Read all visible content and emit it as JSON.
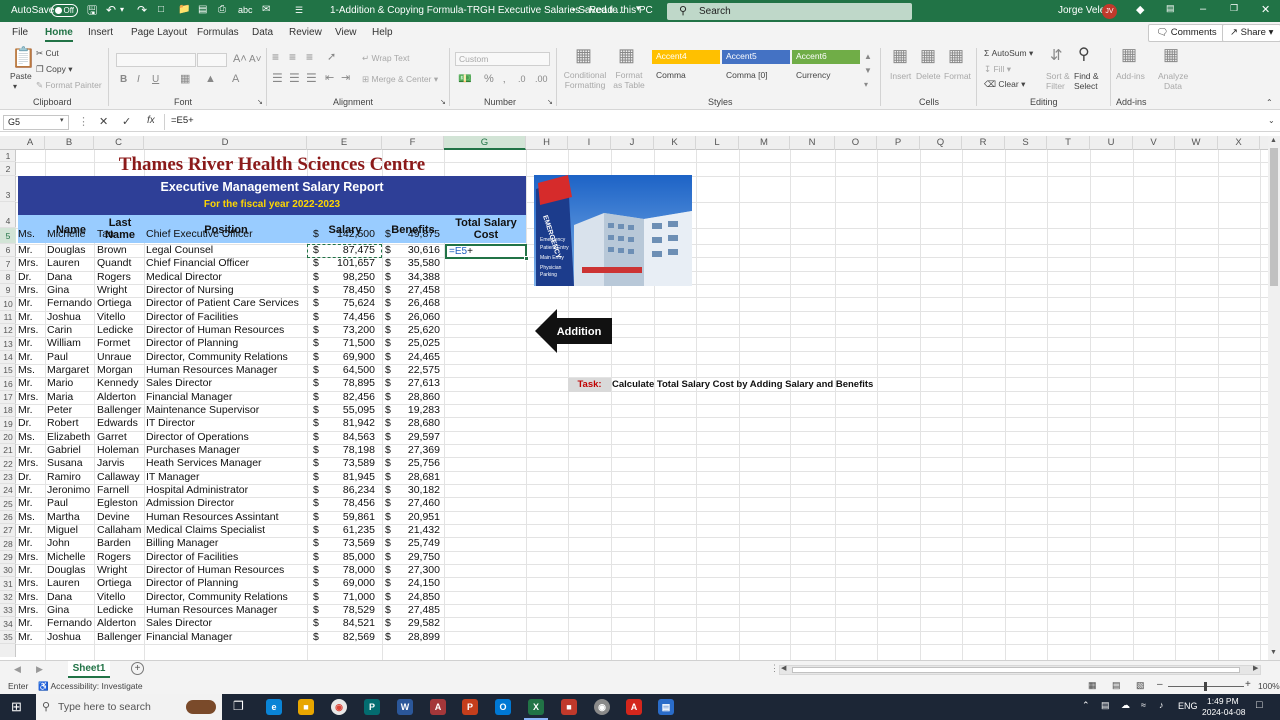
{
  "titlebar": {
    "autosave": "AutoSave",
    "autosave_state": "Off",
    "doc_title": "1-Addition & Copying Formula-TRGH Executive Salaries - Read-...",
    "saved": "• Saved to this PC",
    "search_placeholder": "Search",
    "user": "Jorge Velez",
    "user_initials": "JV"
  },
  "menu": {
    "tabs": [
      "File",
      "Home",
      "Insert",
      "Page Layout",
      "Formulas",
      "Data",
      "Review",
      "View",
      "Help"
    ],
    "comments": "Comments",
    "share": "Share"
  },
  "ribbon": {
    "clipboard": {
      "paste": "Paste",
      "cut": "Cut",
      "copy": "Copy",
      "format_painter": "Format Painter",
      "label": "Clipboard"
    },
    "font": {
      "label": "Font",
      "bold": "B",
      "italic": "I",
      "underline": "U"
    },
    "alignment": {
      "wrap": "Wrap Text",
      "merge": "Merge & Center",
      "label": "Alignment"
    },
    "number": {
      "format": "Custom",
      "label": "Number"
    },
    "styles": {
      "conditional": "Conditional Formatting",
      "format_table": "Format as Table",
      "cells": [
        "Accent4",
        "Accent5",
        "Accent6",
        "Comma",
        "Comma [0]",
        "Currency"
      ],
      "label": "Styles"
    },
    "cells": {
      "insert": "Insert",
      "delete": "Delete",
      "format": "Format",
      "label": "Cells"
    },
    "editing": {
      "autosum": "AutoSum",
      "fill": "Fill",
      "clear": "Clear",
      "sort": "Sort & Filter",
      "find": "Find & Select",
      "label": "Editing"
    },
    "addins": {
      "addins": "Add-ins",
      "analyze": "Analyze Data",
      "label": "Add-ins"
    },
    "accent_colors": {
      "accent4": "#ffc000",
      "accent5": "#4472c4",
      "accent6": "#70ad47"
    }
  },
  "formula_bar": {
    "name_box": "G5",
    "fx": "fx",
    "formula": "=E5+"
  },
  "sheet": {
    "columns": [
      "A",
      "B",
      "C",
      "D",
      "E",
      "F",
      "G",
      "H",
      "I",
      "J",
      "K",
      "L",
      "M",
      "N",
      "O",
      "P",
      "Q",
      "R",
      "S",
      "T",
      "U",
      "V",
      "W",
      "X"
    ],
    "rows": [
      "1",
      "2",
      "3",
      "4",
      "5",
      "6",
      "7",
      "8",
      "9",
      "10",
      "11",
      "12",
      "13",
      "14",
      "15",
      "16",
      "17",
      "18",
      "19",
      "20",
      "21",
      "22",
      "23",
      "24",
      "25",
      "26",
      "27",
      "28",
      "29",
      "30",
      "31",
      "32",
      "33",
      "34",
      "35"
    ],
    "title": "Thames River Health Sciences Centre",
    "subtitle": "Executive Management Salary Report",
    "fiscal": "For the fiscal year 2022-2023",
    "headers": {
      "name": "Name",
      "last_name": "Last Name",
      "position": "Position",
      "salary": "Salary",
      "benefits": "Benefits",
      "total": "Total Salary Cost"
    },
    "currency": "$",
    "editing_text": {
      "ref": "=E5",
      "op": "+"
    },
    "employees": [
      [
        "Ms.",
        "Michelle",
        "Tan",
        "Chief Executive Officer",
        "142,500",
        "49,875"
      ],
      [
        "Mr.",
        "Douglas",
        "Brown",
        "Legal Counsel",
        "87,475",
        "30,616"
      ],
      [
        "Mrs.",
        "Lauren",
        "Quandt",
        "Chief Financial Officer",
        "101,657",
        "35,580"
      ],
      [
        "Dr.",
        "Dana",
        "Rogers",
        "Medical Director",
        "98,250",
        "34,388"
      ],
      [
        "Mrs.",
        "Gina",
        "Wright",
        "Director of Nursing",
        "78,450",
        "27,458"
      ],
      [
        "Mr.",
        "Fernando",
        "Ortiega",
        "Director of Patient Care Services",
        "75,624",
        "26,468"
      ],
      [
        "Mr.",
        "Joshua",
        "Vitello",
        "Director of Facilities",
        "74,456",
        "26,060"
      ],
      [
        "Mrs.",
        "Carin",
        "Ledicke",
        "Director of Human Resources",
        "73,200",
        "25,620"
      ],
      [
        "Mr.",
        "William",
        "Formet",
        "Director of Planning",
        "71,500",
        "25,025"
      ],
      [
        "Mr.",
        "Paul",
        "Unraue",
        "Director, Community Relations",
        "69,900",
        "24,465"
      ],
      [
        "Ms.",
        "Margaret",
        "Morgan",
        "Human Resources Manager",
        "64,500",
        "22,575"
      ],
      [
        "Mr.",
        "Mario",
        "Kennedy",
        "Sales Director",
        "78,895",
        "27,613"
      ],
      [
        "Mrs.",
        "Maria",
        "Alderton",
        "Financial Manager",
        "82,456",
        "28,860"
      ],
      [
        "Mr.",
        "Peter",
        "Ballenger",
        "Maintenance Supervisor",
        "55,095",
        "19,283"
      ],
      [
        "Dr.",
        "Robert",
        "Edwards",
        "IT Director",
        "81,942",
        "28,680"
      ],
      [
        "Ms.",
        "Elizabeth",
        "Garret",
        "Director of Operations",
        "84,563",
        "29,597"
      ],
      [
        "Mr.",
        "Gabriel",
        "Holeman",
        "Purchases Manager",
        "78,198",
        "27,369"
      ],
      [
        "Mrs.",
        "Susana",
        "Jarvis",
        "Heath Services Manager",
        "73,589",
        "25,756"
      ],
      [
        "Dr.",
        "Ramiro",
        "Callaway",
        "IT Manager",
        "81,945",
        "28,681"
      ],
      [
        "Mr.",
        "Jeronimo",
        "Farnell",
        "Hospital Administrator",
        "86,234",
        "30,182"
      ],
      [
        "Mr.",
        "Paul",
        "Egleston",
        "Admission Director",
        "78,456",
        "27,460"
      ],
      [
        "Ms.",
        "Martha",
        "Devine",
        "Human Resources Assintant",
        "59,861",
        "20,951"
      ],
      [
        "Mr.",
        "Miguel",
        "Callaham",
        "Medical Claims Specialist",
        "61,235",
        "21,432"
      ],
      [
        "Mr.",
        "John",
        "Barden",
        "Billing Manager",
        "73,569",
        "25,749"
      ],
      [
        "Mrs.",
        "Michelle",
        "Rogers",
        "Director of Facilities",
        "85,000",
        "29,750"
      ],
      [
        "Mr.",
        "Douglas",
        "Wright",
        "Director of Human Resources",
        "78,000",
        "27,300"
      ],
      [
        "Mrs.",
        "Lauren",
        "Ortiega",
        "Director of Planning",
        "69,000",
        "24,150"
      ],
      [
        "Mrs.",
        "Dana",
        "Vitello",
        "Director, Community Relations",
        "71,000",
        "24,850"
      ],
      [
        "Mrs.",
        "Gina",
        "Ledicke",
        "Human Resources Manager",
        "78,529",
        "27,485"
      ],
      [
        "Mr.",
        "Fernando",
        "Alderton",
        "Sales Director",
        "84,521",
        "29,582"
      ],
      [
        "Mr.",
        "Joshua",
        "Ballenger",
        "Financial Manager",
        "82,569",
        "28,899"
      ]
    ],
    "photo_sign": [
      "EMERGENCY",
      "Emergency",
      "Patient Entry",
      "Main Entry",
      "Physician",
      "Parking"
    ],
    "arrow_label": "Addition",
    "task_label": "Task:",
    "task_text": "Calculate Total Salary Cost by Adding Salary and Benefits"
  },
  "sheet_tabs": {
    "active": "Sheet1",
    "add": "+"
  },
  "statusbar": {
    "mode": "Enter",
    "accessibility": "Accessibility: Investigate",
    "zoom": "100%"
  },
  "taskbar": {
    "search": "Type here to search",
    "lang": "ENG",
    "time": "1:49 PM",
    "date": "2024-04-08"
  }
}
